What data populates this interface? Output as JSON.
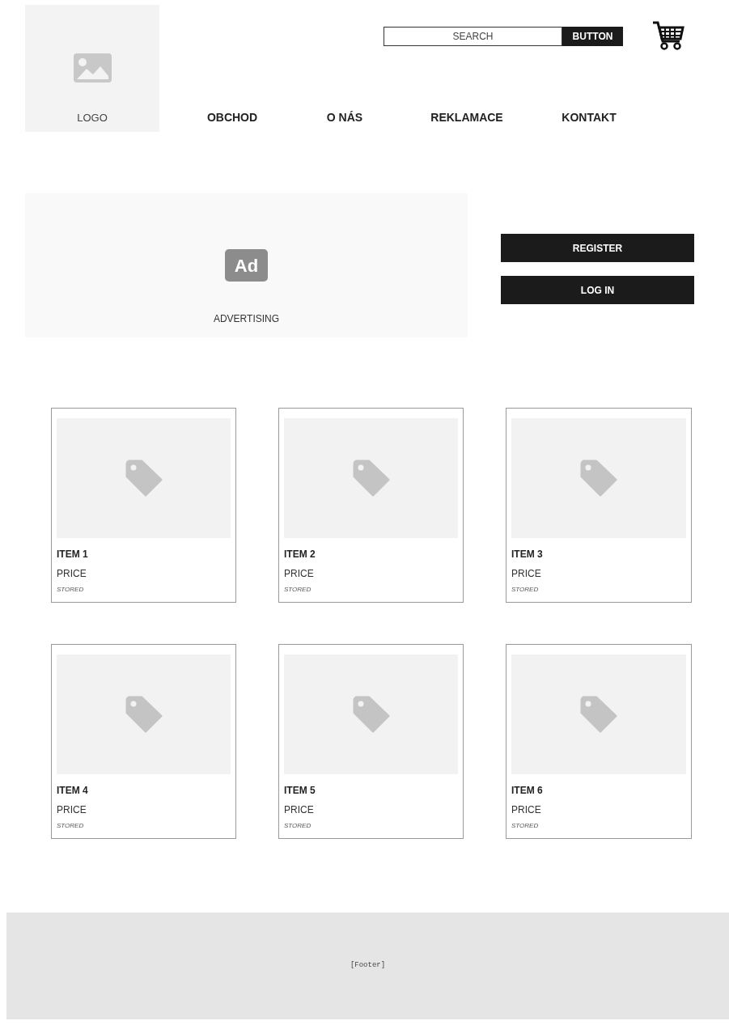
{
  "header": {
    "logo": {
      "label": "LOGO"
    },
    "search": {
      "placeholder": "SEARCH"
    },
    "search_button": "BUTTON",
    "nav": [
      {
        "label": "OBCHOD"
      },
      {
        "label": "O NÁS"
      },
      {
        "label": "REKLAMACE"
      },
      {
        "label": "KONTAKT"
      }
    ]
  },
  "ad": {
    "icon_text": "Ad",
    "label": "ADVERTISING"
  },
  "auth_buttons": [
    "REGISTER",
    "LOG IN"
  ],
  "products": [
    {
      "name": "ITEM 1",
      "price": "PRICE",
      "stock": "STORED"
    },
    {
      "name": "ITEM 2",
      "price": "PRICE",
      "stock": "STORED"
    },
    {
      "name": "ITEM 3",
      "price": "PRICE",
      "stock": "STORED"
    },
    {
      "name": "ITEM 4",
      "price": "PRICE",
      "stock": "STORED"
    },
    {
      "name": "ITEM 5",
      "price": "PRICE",
      "stock": "STORED"
    },
    {
      "name": "ITEM 6",
      "price": "PRICE",
      "stock": "STORED"
    }
  ],
  "footer": "[Footer]"
}
